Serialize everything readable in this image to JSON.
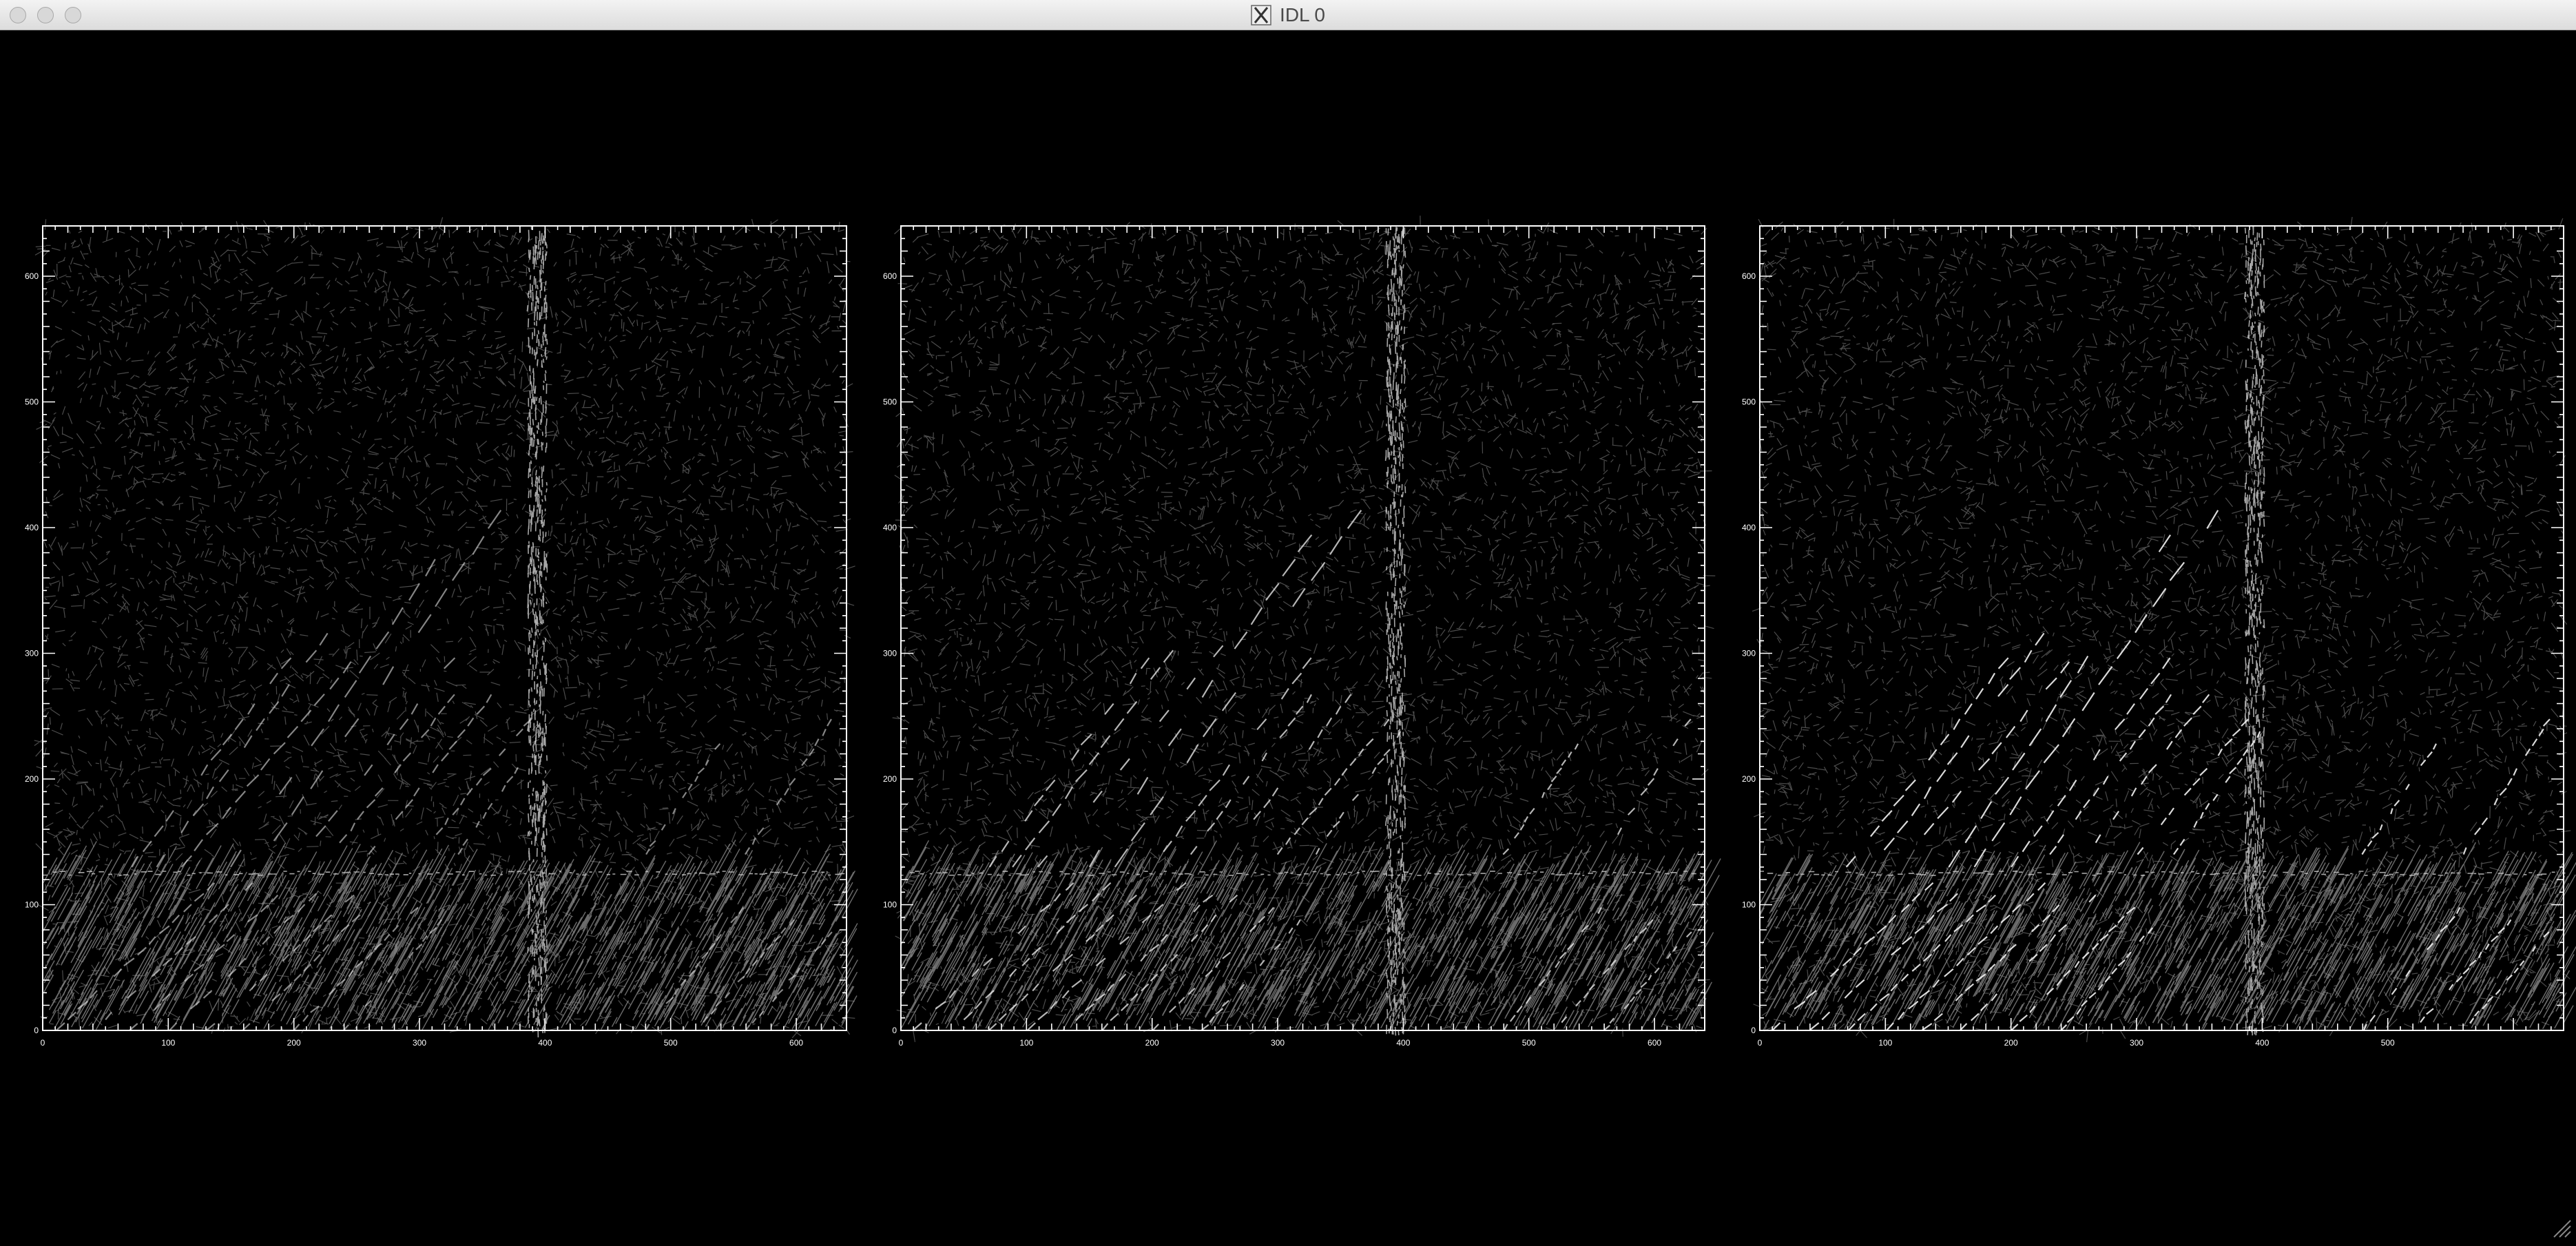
{
  "window": {
    "title": "IDL 0",
    "icon": "x11-icon",
    "controls": [
      "close-button",
      "minimize-button",
      "zoom-button"
    ]
  },
  "plot_area_background": "#000000",
  "plot_foreground": "#ffffff",
  "panels": [
    {
      "name": "panel-1",
      "x_range": [
        0,
        640
      ],
      "y_range": [
        0,
        640
      ],
      "x_ticks": [
        "0",
        "100",
        "200",
        "300",
        "400",
        "500",
        "600"
      ],
      "y_ticks": [
        "0",
        "100",
        "200",
        "300",
        "400",
        "500",
        "600"
      ],
      "streak_intensity": 0.55
    },
    {
      "name": "panel-2",
      "x_range": [
        0,
        640
      ],
      "y_range": [
        0,
        640
      ],
      "x_ticks": [
        "0",
        "100",
        "200",
        "300",
        "400",
        "500",
        "600"
      ],
      "y_ticks": [
        "0",
        "100",
        "200",
        "300",
        "400",
        "500",
        "600"
      ],
      "streak_intensity": 0.75
    },
    {
      "name": "panel-3",
      "x_range": [
        0,
        640
      ],
      "y_range": [
        0,
        640
      ],
      "x_ticks": [
        "0",
        "100",
        "200",
        "300",
        "400",
        "500"
      ],
      "y_ticks": [
        "0",
        "100",
        "200",
        "300",
        "400",
        "500",
        "600"
      ],
      "streak_intensity": 0.9
    }
  ]
}
